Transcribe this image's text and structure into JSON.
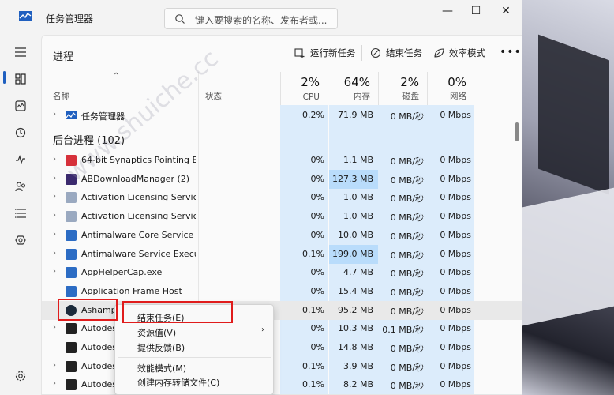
{
  "window": {
    "title": "任务管理器",
    "search_placeholder": "键入要搜索的名称、发布者或...",
    "minimize": "—",
    "maximize": "☐",
    "close": "✕"
  },
  "sidebar": {
    "items": [
      "menu-icon",
      "processes-icon",
      "performance-icon",
      "app-history-icon",
      "startup-icon",
      "users-icon",
      "details-icon",
      "services-icon"
    ],
    "settings": "settings-icon"
  },
  "toolbar": {
    "title": "进程",
    "run_new_task": "运行新任务",
    "end_task": "结束任务",
    "efficiency_mode": "效率模式",
    "more": "•••"
  },
  "columns": {
    "name": "名称",
    "status": "状态",
    "cpu": {
      "pct": "2%",
      "label": "CPU"
    },
    "memory": {
      "pct": "64%",
      "label": "内存"
    },
    "disk": {
      "pct": "2%",
      "label": "磁盘"
    },
    "network": {
      "pct": "0%",
      "label": "网络"
    }
  },
  "apps_row": {
    "name": "任务管理器",
    "cpu": "0.2%",
    "mem": "71.9 MB",
    "disk": "0 MB/秒",
    "net": "0 Mbps"
  },
  "background_header": "后台进程 (102)",
  "processes": [
    {
      "name": "64-bit Synaptics Pointing E...",
      "cpu": "0%",
      "mem": "1.1 MB",
      "disk": "0 MB/秒",
      "net": "0 Mbps",
      "icon_color": "#d6303a",
      "expand": true
    },
    {
      "name": "ABDownloadManager (2)",
      "cpu": "0%",
      "mem": "127.3 MB",
      "disk": "0 MB/秒",
      "net": "0 Mbps",
      "icon_color": "#3b2a6e",
      "expand": true
    },
    {
      "name": "Activation Licensing Service",
      "cpu": "0%",
      "mem": "1.0 MB",
      "disk": "0 MB/秒",
      "net": "0 Mbps",
      "icon_color": "#9aa9c0",
      "expand": true
    },
    {
      "name": "Activation Licensing Service...",
      "cpu": "0%",
      "mem": "1.0 MB",
      "disk": "0 MB/秒",
      "net": "0 Mbps",
      "icon_color": "#9aa9c0",
      "expand": true
    },
    {
      "name": "Antimalware Core Service",
      "cpu": "0%",
      "mem": "10.0 MB",
      "disk": "0 MB/秒",
      "net": "0 Mbps",
      "icon_color": "#2c6cc4",
      "expand": true
    },
    {
      "name": "Antimalware Service Execut...",
      "cpu": "0.1%",
      "mem": "199.0 MB",
      "disk": "0 MB/秒",
      "net": "0 Mbps",
      "icon_color": "#2c6cc4",
      "expand": true
    },
    {
      "name": "AppHelperCap.exe",
      "cpu": "0%",
      "mem": "4.7 MB",
      "disk": "0 MB/秒",
      "net": "0 Mbps",
      "icon_color": "#2c6cc4",
      "expand": true
    },
    {
      "name": "Application Frame Host",
      "cpu": "0%",
      "mem": "15.4 MB",
      "disk": "0 MB/秒",
      "net": "0 Mbps",
      "icon_color": "#2c6cc4",
      "expand": false
    },
    {
      "name": "Ashamp",
      "cpu": "0.1%",
      "mem": "95.2 MB",
      "disk": "0 MB/秒",
      "net": "0 Mbps",
      "icon_color": "#1b2a3a",
      "expand": false
    },
    {
      "name": "Autodes",
      "cpu": "0%",
      "mem": "10.3 MB",
      "disk": "0.1 MB/秒",
      "net": "0 Mbps",
      "icon_color": "#222222",
      "expand": true
    },
    {
      "name": "Autodes",
      "cpu": "0%",
      "mem": "14.8 MB",
      "disk": "0 MB/秒",
      "net": "0 Mbps",
      "icon_color": "#222222",
      "expand": false
    },
    {
      "name": "Autodes",
      "cpu": "0.1%",
      "mem": "3.9 MB",
      "disk": "0 MB/秒",
      "net": "0 Mbps",
      "icon_color": "#222222",
      "expand": true
    },
    {
      "name": "Autodes",
      "cpu": "0.1%",
      "mem": "8.2 MB",
      "disk": "0 MB/秒",
      "net": "0 Mbps",
      "icon_color": "#222222",
      "expand": true
    }
  ],
  "context_menu": {
    "end_task": "结束任务(E)",
    "resource_values": "资源值(V)",
    "feedback": "提供反馈(B)",
    "efficiency_mode": "效能模式(M)",
    "create_dump": "创建内存转储文件(C)",
    "submenu_arrow": "›"
  },
  "watermark": "www.shuiche.cc",
  "colors": {
    "highlight": "#b9dcfb",
    "cell_bg": "#dcecfb",
    "selected_row": "#e5e5e5",
    "annotation_red": "#e01c1c",
    "accent": "#1f5fbf"
  }
}
